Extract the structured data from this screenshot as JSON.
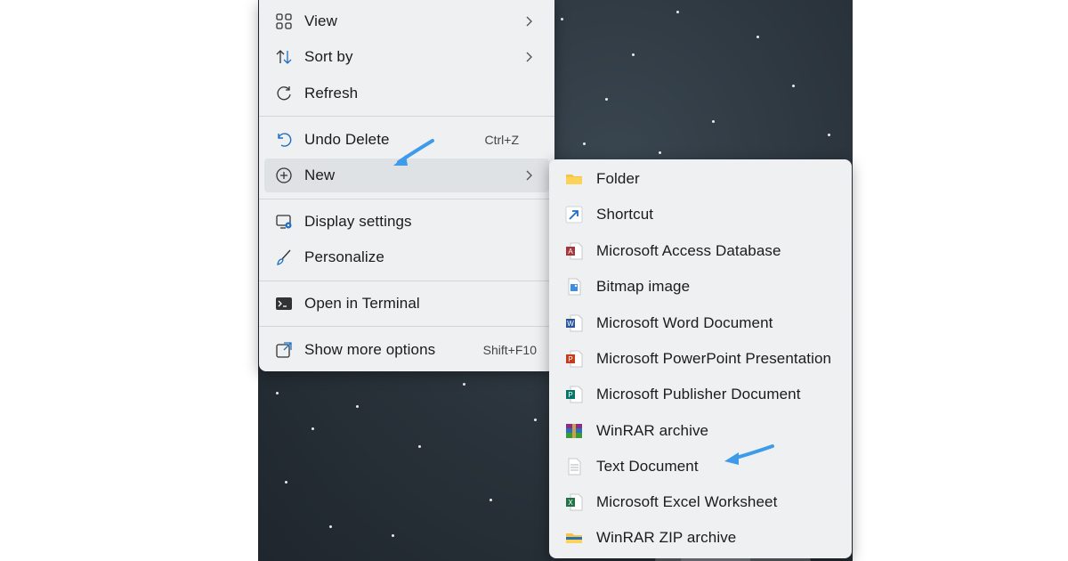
{
  "context_menu": {
    "items": [
      {
        "label": "View",
        "icon": "view-grid-icon",
        "submenu": true
      },
      {
        "label": "Sort by",
        "icon": "sort-icon",
        "submenu": true
      },
      {
        "label": "Refresh",
        "icon": "refresh-icon"
      },
      {
        "label": "Undo Delete",
        "icon": "undo-icon",
        "shortcut": "Ctrl+Z"
      },
      {
        "label": "New",
        "icon": "new-plus-icon",
        "submenu": true
      },
      {
        "label": "Display settings",
        "icon": "display-settings-icon"
      },
      {
        "label": "Personalize",
        "icon": "personalize-brush-icon"
      },
      {
        "label": "Open in Terminal",
        "icon": "terminal-icon"
      },
      {
        "label": "Show more options",
        "icon": "show-more-icon",
        "shortcut": "Shift+F10"
      }
    ]
  },
  "new_submenu": {
    "items": [
      {
        "label": "Folder",
        "icon": "folder-icon"
      },
      {
        "label": "Shortcut",
        "icon": "shortcut-icon"
      },
      {
        "label": "Microsoft Access Database",
        "icon": "access-icon"
      },
      {
        "label": "Bitmap image",
        "icon": "bitmap-icon"
      },
      {
        "label": "Microsoft Word Document",
        "icon": "word-icon"
      },
      {
        "label": "Microsoft PowerPoint Presentation",
        "icon": "powerpoint-icon"
      },
      {
        "label": "Microsoft Publisher Document",
        "icon": "publisher-icon"
      },
      {
        "label": "WinRAR archive",
        "icon": "winrar-icon"
      },
      {
        "label": "Text Document",
        "icon": "text-document-icon"
      },
      {
        "label": "Microsoft Excel Worksheet",
        "icon": "excel-icon"
      },
      {
        "label": "WinRAR ZIP archive",
        "icon": "winrar-zip-icon"
      }
    ]
  },
  "colors": {
    "menu_bg": "#eef0f2",
    "hover_bg": "#dfe2e5",
    "annotation_arrow": "#3d9be9",
    "access": "#a4373a",
    "word": "#2b579a",
    "powerpoint": "#c43e1c",
    "publisher": "#077568",
    "excel": "#217346"
  }
}
